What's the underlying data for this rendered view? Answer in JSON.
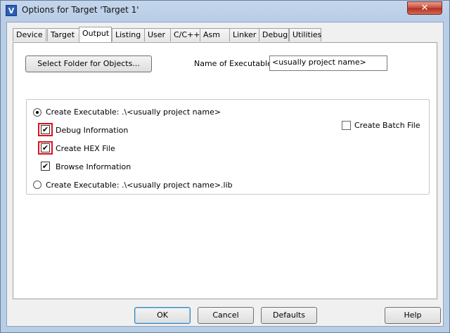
{
  "window": {
    "title": "Options for Target 'Target 1'",
    "close_glyph": "✕"
  },
  "tabs": [
    {
      "label": "Device"
    },
    {
      "label": "Target"
    },
    {
      "label": "Output"
    },
    {
      "label": "Listing"
    },
    {
      "label": "User"
    },
    {
      "label": "C/C++"
    },
    {
      "label": "Asm"
    },
    {
      "label": "Linker"
    },
    {
      "label": "Debug"
    },
    {
      "label": "Utilities"
    }
  ],
  "active_tab": "Output",
  "output": {
    "select_folder_label": "Select Folder for Objects...",
    "name_label": "Name of Executable:",
    "name_value": "<usually project name>",
    "create_exe_label": "Create Executable:  .\\<usually project name>",
    "create_exe_selected": true,
    "debug_info_label": "Debug Information",
    "debug_info_checked": true,
    "hex_file_label": "Create HEX File",
    "hex_file_checked": true,
    "browse_info_label": "Browse Information",
    "browse_info_checked": true,
    "create_lib_label": "Create Executable:  .\\<usually project name>.lib",
    "create_lib_selected": false,
    "batch_file_label": "Create Batch File",
    "batch_file_checked": false,
    "check_glyph": "✔"
  },
  "buttons": {
    "ok": "OK",
    "cancel": "Cancel",
    "defaults": "Defaults",
    "help": "Help"
  },
  "colors": {
    "highlight": "#e0101b",
    "title_bar": "#b8cde6",
    "close": "#c7493a"
  }
}
